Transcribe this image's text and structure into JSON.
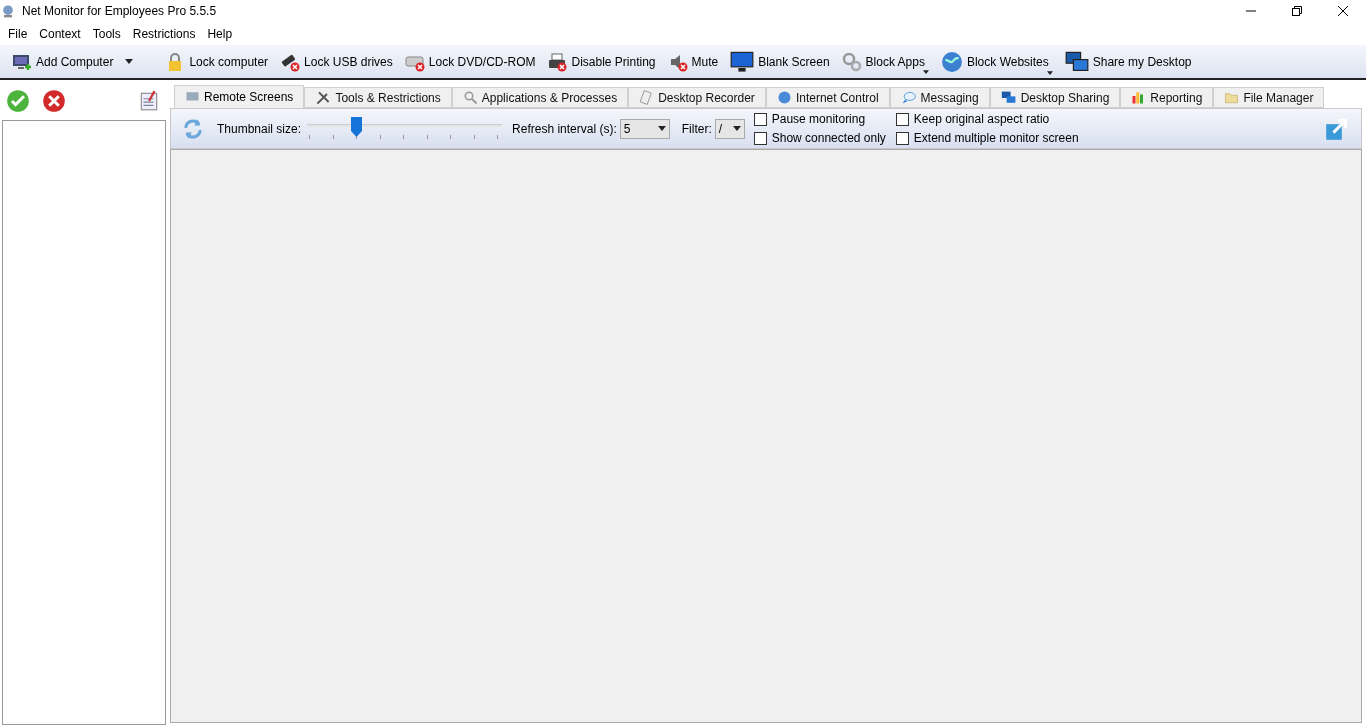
{
  "window": {
    "title": "Net Monitor for Employees Pro 5.5.5"
  },
  "menu": [
    "File",
    "Context",
    "Tools",
    "Restrictions",
    "Help"
  ],
  "toolbar": [
    {
      "label": "Add Computer",
      "has_menu": true
    },
    {
      "label": "Lock computer",
      "has_menu": false
    },
    {
      "label": "Lock USB drives",
      "has_menu": false
    },
    {
      "label": "Lock DVD/CD-ROM",
      "has_menu": false
    },
    {
      "label": "Disable Printing",
      "has_menu": false
    },
    {
      "label": "Mute",
      "has_menu": false
    },
    {
      "label": "Blank Screen",
      "has_menu": false
    },
    {
      "label": "Block Apps",
      "has_menu": true
    },
    {
      "label": "Block Websites",
      "has_menu": true
    },
    {
      "label": "Share my Desktop",
      "has_menu": false
    }
  ],
  "tabs": [
    {
      "label": "Remote Screens",
      "selected": true
    },
    {
      "label": "Tools & Restrictions",
      "selected": false
    },
    {
      "label": "Applications & Processes",
      "selected": false
    },
    {
      "label": "Desktop Recorder",
      "selected": false
    },
    {
      "label": "Internet Control",
      "selected": false
    },
    {
      "label": "Messaging",
      "selected": false
    },
    {
      "label": "Desktop Sharing",
      "selected": false
    },
    {
      "label": "Reporting",
      "selected": false
    },
    {
      "label": "File Manager",
      "selected": false
    }
  ],
  "options": {
    "thumbnail_label": "Thumbnail size:",
    "thumbnail": {
      "level": 0.24
    },
    "refresh_label": "Refresh interval (s):",
    "refresh_value": "5",
    "filter_label": "Filter:",
    "filter_value": "/",
    "checkboxes": [
      {
        "label": "Pause monitoring",
        "checked": false
      },
      {
        "label": "Show connected only",
        "checked": false
      },
      {
        "label": "Keep original aspect ratio",
        "checked": false
      },
      {
        "label": "Extend multiple monitor screen",
        "checked": false
      }
    ]
  }
}
